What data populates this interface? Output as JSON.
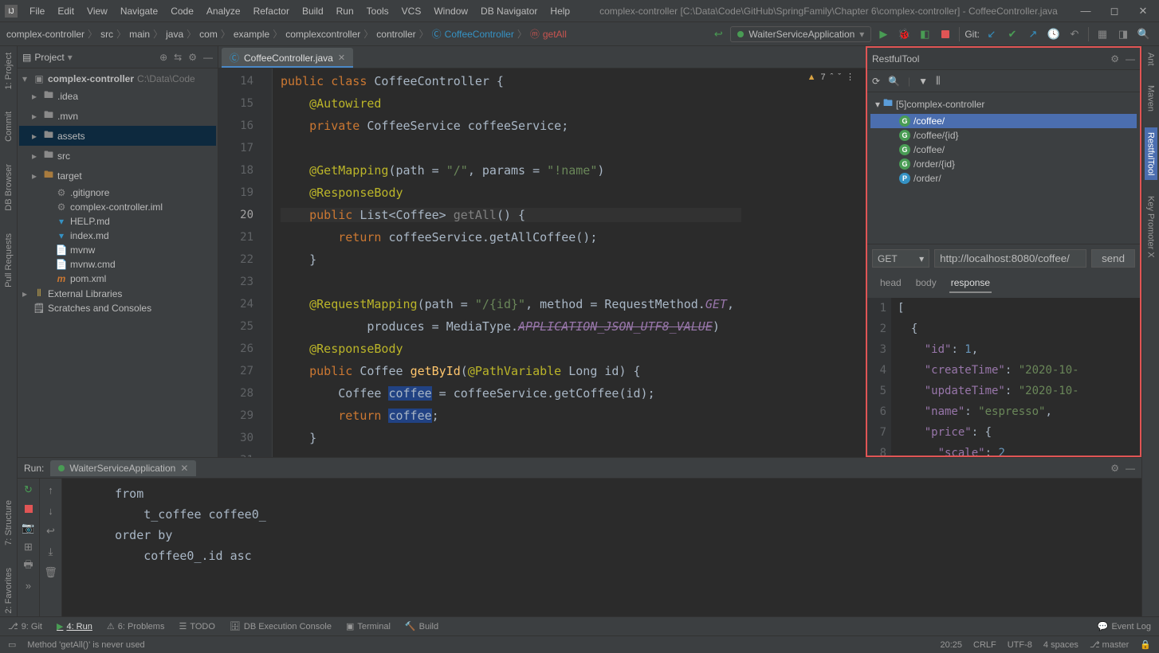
{
  "title": "complex-controller [C:\\Data\\Code\\GitHub\\SpringFamily\\Chapter 6\\complex-controller] - CoffeeController.java",
  "menu": [
    "File",
    "Edit",
    "View",
    "Navigate",
    "Code",
    "Analyze",
    "Refactor",
    "Build",
    "Run",
    "Tools",
    "VCS",
    "Window",
    "DB Navigator",
    "Help"
  ],
  "breadcrumb": [
    "complex-controller",
    "src",
    "main",
    "java",
    "com",
    "example",
    "complexcontroller",
    "controller",
    "CoffeeController",
    "getAll"
  ],
  "runConfig": "WaiterServiceApplication",
  "gitLabel": "Git:",
  "projectPane": {
    "title": "Project",
    "root": "complex-controller",
    "rootPath": "C:\\Data\\Code",
    "items": [
      {
        "label": ".idea",
        "type": "folder"
      },
      {
        "label": ".mvn",
        "type": "folder"
      },
      {
        "label": "assets",
        "type": "folder",
        "selected": true
      },
      {
        "label": "src",
        "type": "folder"
      },
      {
        "label": "target",
        "type": "folder",
        "orange": true
      },
      {
        "label": ".gitignore",
        "type": "file-gear"
      },
      {
        "label": "complex-controller.iml",
        "type": "file-gear"
      },
      {
        "label": "HELP.md",
        "type": "file-md"
      },
      {
        "label": "index.md",
        "type": "file-md"
      },
      {
        "label": "mvnw",
        "type": "file"
      },
      {
        "label": "mvnw.cmd",
        "type": "file"
      },
      {
        "label": "pom.xml",
        "type": "file-xml"
      }
    ],
    "extLib": "External Libraries",
    "scratches": "Scratches and Consoles"
  },
  "editor": {
    "tab": "CoffeeController.java",
    "warnCount": "7",
    "lines": [
      14,
      15,
      16,
      17,
      18,
      19,
      20,
      21,
      22,
      23,
      24,
      25,
      26,
      27,
      28,
      29,
      30,
      31
    ],
    "currentLine": 20
  },
  "restful": {
    "title": "RestfulTool",
    "treeRoot": "[5]complex-controller",
    "endpoints": [
      {
        "m": "G",
        "path": "/coffee/",
        "sel": true
      },
      {
        "m": "G",
        "path": "/coffee/{id}"
      },
      {
        "m": "G",
        "path": "/coffee/"
      },
      {
        "m": "G",
        "path": "/order/{id}"
      },
      {
        "m": "P",
        "path": "/order/"
      }
    ],
    "method": "GET",
    "url": "http://localhost:8080/coffee/",
    "send": "send",
    "tabs": [
      "head",
      "body",
      "response"
    ],
    "activeTab": "response",
    "respLines": [
      1,
      2,
      3,
      4,
      5,
      6,
      7,
      8
    ]
  },
  "run": {
    "title": "Run:",
    "tab": "WaiterServiceApplication",
    "console": "    from\n        t_coffee coffee0_ \n    order by\n        coffee0_.id asc"
  },
  "bottomTabs": {
    "git": "9: Git",
    "run": "4: Run",
    "problems": "6: Problems",
    "todo": "TODO",
    "db": "DB Execution Console",
    "terminal": "Terminal",
    "build": "Build",
    "eventLog": "Event Log"
  },
  "status": {
    "msg": "Method 'getAll()' is never used",
    "cursor": "20:25",
    "sep": "CRLF",
    "enc": "UTF-8",
    "indent": "4 spaces",
    "branch": "master"
  },
  "leftRail": [
    "1: Project",
    "Commit",
    "DB Browser",
    "Pull Requests"
  ],
  "leftRail2": [
    "7: Structure",
    "2: Favorites"
  ],
  "rightRail": [
    "Ant",
    "Maven",
    "RestfulTool",
    "Key Promoter X"
  ]
}
